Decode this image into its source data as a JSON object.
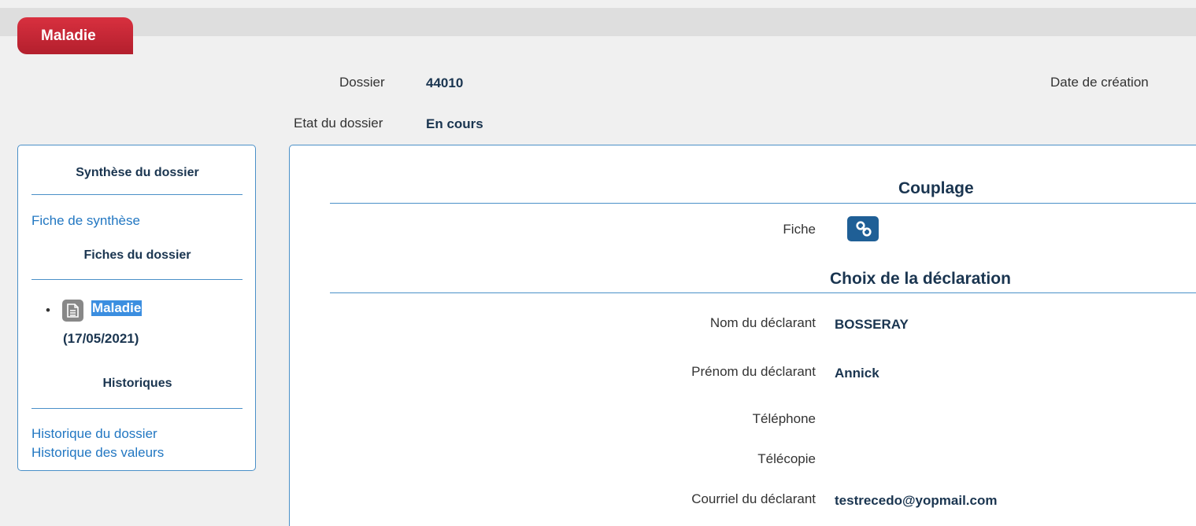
{
  "tab": {
    "label": "Maladie"
  },
  "header": {
    "dossier_label": "Dossier",
    "dossier_value": "44010",
    "etat_label": "Etat du dossier",
    "etat_value": "En cours",
    "date_creation_label": "Date de création"
  },
  "sidebar": {
    "synthese_heading": "Synthèse du dossier",
    "fiche_synthese_link": "Fiche de synthèse",
    "fiches_heading": "Fiches du dossier",
    "fiche_item": {
      "name": "Maladie",
      "date": "(17/05/2021)",
      "icon": "document-icon"
    },
    "historiques_heading": "Historiques",
    "historique_dossier_link": "Historique du dossier",
    "historique_valeurs_link": "Historique des valeurs"
  },
  "main": {
    "couplage_title": "Couplage",
    "fiche_label": "Fiche",
    "fiche_button_icon": "link-icon",
    "choix_title": "Choix de la déclaration",
    "fields": [
      {
        "label": "Nom du déclarant",
        "value": "BOSSERAY"
      },
      {
        "label": "Prénom du déclarant",
        "value": "Annick"
      },
      {
        "label": "Téléphone",
        "value": ""
      },
      {
        "label": "Télécopie",
        "value": ""
      },
      {
        "label": "Courriel du déclarant",
        "value": "testrecedo@yopmail.com"
      }
    ]
  },
  "colors": {
    "tab_red": "#c8283a",
    "link_blue": "#2277c2",
    "border_blue": "#4a90c8",
    "dark_navy": "#1a3550",
    "button_blue": "#1f5f96"
  }
}
